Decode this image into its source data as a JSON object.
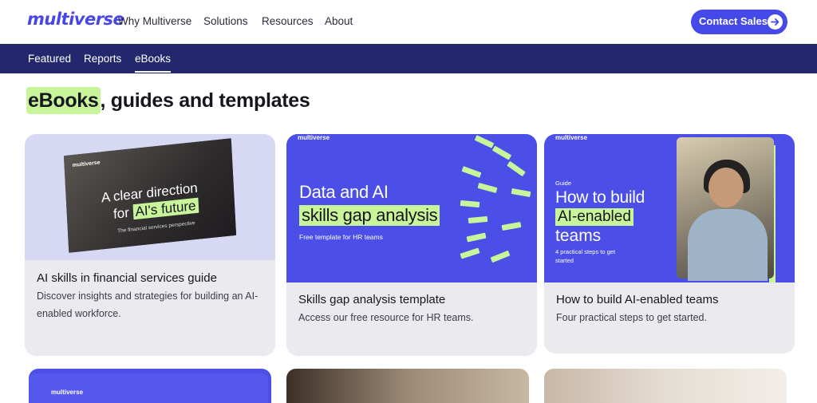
{
  "header": {
    "logo": "multiverse",
    "nav": [
      "Why Multiverse",
      "Solutions",
      "Resources",
      "About"
    ],
    "cta": "Contact Sales"
  },
  "subnav": {
    "items": [
      "Featured",
      "Reports",
      "eBooks"
    ],
    "active": "eBooks"
  },
  "page": {
    "title_highlight": "eBooks",
    "title_rest": ", guides and templates"
  },
  "cards": [
    {
      "title": "AI skills in financial services guide",
      "description": "Discover insights and strategies for building an AI-enabled workforce.",
      "image": {
        "brand": "multiverse",
        "line1": "A clear direction",
        "line2_pre": "for ",
        "line2_hl": "AI's future",
        "small": "The financial services perspective"
      }
    },
    {
      "title": "Skills gap analysis template",
      "description": "Access our free resource for HR teams.",
      "image": {
        "brand": "multiverse",
        "line1": "Data and AI",
        "line2": "skills gap analysis",
        "sub": "Free template for HR teams"
      }
    },
    {
      "title": "How to build AI-enabled teams",
      "description": "Four practical steps to get started.",
      "image": {
        "brand": "multiverse",
        "tag": "Guide",
        "line1": "How to build",
        "line2": "AI-enabled",
        "line3": "teams",
        "sub": "4 practical steps to get started"
      }
    }
  ],
  "bottom_cards": [
    {
      "brand": "multiverse"
    }
  ],
  "colors": {
    "brand": "#4747e6",
    "subnav": "#22286b",
    "highlight": "#c8f59a",
    "card_bg": "#ebebef"
  },
  "icons": [
    "arrow-right-icon"
  ]
}
